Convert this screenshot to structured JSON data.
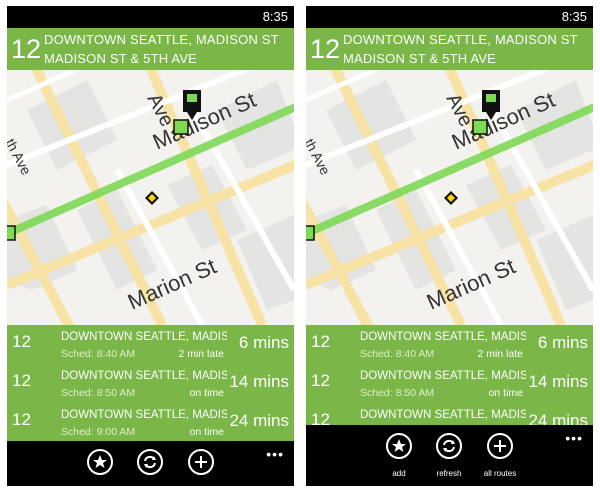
{
  "status_bar": {
    "time": "8:35"
  },
  "route": {
    "number": "12",
    "destination": "DOWNTOWN SEATTLE, MADISON ST",
    "stop": "MADISON ST & 5TH AVE"
  },
  "map": {
    "street_labels": [
      "Madison St",
      "Ave",
      "Marion St",
      "th Ave"
    ],
    "colors": {
      "route_line": "#7ed957",
      "road": "#f7e3a5",
      "block": "#e6e6e6",
      "marker": "#111111",
      "stop_marker": "#ffd800"
    },
    "icons": [
      "bus-stop-icon",
      "bus-icon",
      "location-diamond-icon"
    ]
  },
  "arrivals": [
    {
      "route": "12",
      "destination": "DOWNTOWN SEATTLE, MADISON ST",
      "sched": "Sched: 8:40 AM",
      "status": "2 min late",
      "mins": "6 mins"
    },
    {
      "route": "12",
      "destination": "DOWNTOWN SEATTLE, MADISON ST",
      "sched": "Sched: 8:50 AM",
      "status": "on time",
      "mins": "14 mins"
    },
    {
      "route": "12",
      "destination": "DOWNTOWN SEATTLE, MADISON ST",
      "sched": "Sched: 9:00 AM",
      "status": "on time",
      "mins": "24 mins"
    }
  ],
  "app_bar": {
    "buttons": [
      {
        "icon": "add-favorite-icon",
        "label": "add"
      },
      {
        "icon": "refresh-icon",
        "label": "refresh"
      },
      {
        "icon": "all-routes-icon",
        "label": "all routes"
      }
    ],
    "more": "•••"
  },
  "theme": {
    "accent": "#7ab648",
    "background": "#000000"
  }
}
